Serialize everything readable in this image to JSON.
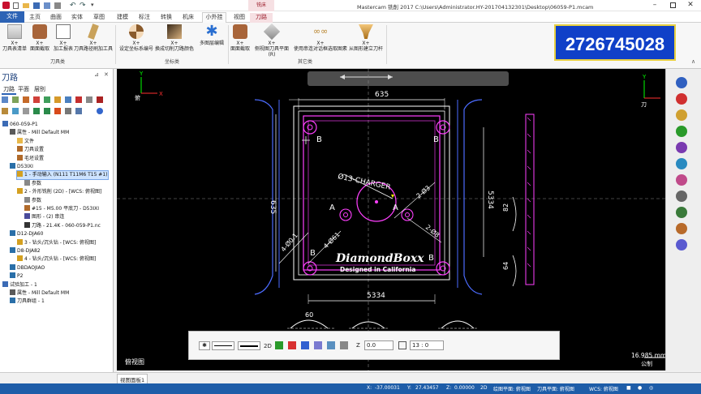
{
  "titlebar": {
    "title": "Mastercam 铣削 2017  C:\\Users\\Administrator.HY-201704132301\\Desktop\\06059-P1.mcam",
    "context_tab": "铣床"
  },
  "tabs": [
    "文件",
    "主页",
    "曲面",
    "实体",
    "草图",
    "建模",
    "标注",
    "转换",
    "机床",
    "小外挂",
    "视图",
    "刀路"
  ],
  "ribbon": {
    "buttons": [
      {
        "top": "X+",
        "label": "刀具表清单"
      },
      {
        "top": "X+",
        "label": "面面截取"
      },
      {
        "top": "X+",
        "label": "加工报表"
      },
      {
        "top": "X+",
        "label": "刀具路径刷加工具"
      },
      {
        "top": "X+",
        "label": "设定坐标系编号"
      },
      {
        "top": "X+",
        "label": "换成切削刀路颜色"
      },
      {
        "top": "",
        "label": "多图层编辑"
      },
      {
        "top": "X+",
        "label": "面面截取"
      },
      {
        "top": "X+",
        "label": "侧视图刀具平面(R)"
      },
      {
        "top": "X+",
        "label": "使用串连对话框选取图素"
      },
      {
        "top": "X+",
        "label": "从图形建立刀杆"
      }
    ],
    "groups": [
      "刀具类",
      "坐标类",
      "其它类"
    ]
  },
  "overlay_number": "2726745028",
  "left": {
    "panel_title": "刀路",
    "subtabs": [
      "刀路",
      "平面",
      "层别"
    ],
    "tree": [
      {
        "t": "060-059-P1",
        "lv": 0,
        "ic": "mach"
      },
      {
        "t": "属性 - Mill Default MM",
        "lv": 1,
        "ic": "prop"
      },
      {
        "t": "文件",
        "lv": 2,
        "ic": "folder"
      },
      {
        "t": "刀具设置",
        "lv": 2,
        "ic": "tool"
      },
      {
        "t": "毛坯设置",
        "lv": 2,
        "ic": "tool"
      },
      {
        "t": "D53IXI",
        "lv": 1,
        "ic": "grp"
      },
      {
        "t": "1 - 手动输入 (N111 T11M6 T15 #1)",
        "lv": 2,
        "ic": "op",
        "sel": true
      },
      {
        "t": "参数",
        "lv": 3,
        "ic": "param"
      },
      {
        "t": "2 - 外形铣削 (2D) - [WCS: 俯视图]",
        "lv": 2,
        "ic": "op"
      },
      {
        "t": "参数",
        "lv": 3,
        "ic": "param"
      },
      {
        "t": "#15 - M5.00 平底刀 - D53IXI",
        "lv": 3,
        "ic": "tool"
      },
      {
        "t": "图形 - (2) 串连",
        "lv": 3,
        "ic": "geo"
      },
      {
        "t": "刀路 - 21.4K - 060-059-P1.nc",
        "lv": 3,
        "ic": "path"
      },
      {
        "t": "D12-DJA60",
        "lv": 1,
        "ic": "grp"
      },
      {
        "t": "3 - 钻头/沉头钻 - [WCS: 俯视图]",
        "lv": 2,
        "ic": "op"
      },
      {
        "t": "D8-DJA82",
        "lv": 1,
        "ic": "grp"
      },
      {
        "t": "4 - 钻头/沉头钻 - [WCS: 俯视图]",
        "lv": 2,
        "ic": "op"
      },
      {
        "t": "DBDAOJIAO",
        "lv": 1,
        "ic": "grp"
      },
      {
        "t": "P2",
        "lv": 1,
        "ic": "grp"
      },
      {
        "t": "试验加工 - 1",
        "lv": 0,
        "ic": "mach"
      },
      {
        "t": "属性 - Mill Default MM",
        "lv": 1,
        "ic": "prop"
      },
      {
        "t": "刀具群组 - 1",
        "lv": 1,
        "ic": "grp"
      }
    ]
  },
  "drawing": {
    "dims": {
      "top": "635",
      "left": "635",
      "right": "5334",
      "bottom": "5334",
      "arc_bottom": "60",
      "rt1": "82",
      "rt2": "64",
      "diag1": "2-Ø3",
      "diag2": "2-Ø8",
      "diag3": "4-Ø0.1",
      "diag4": "4-Ø61",
      "charger": "Ø13-CHARGER"
    },
    "labels": {
      "a1": "A",
      "a2": "A",
      "b": "B"
    },
    "logo_line1": "DiamondBoxx",
    "logo_line2": "Designed in California",
    "view_left": "俯视图",
    "view_top": "俯",
    "axis_x": "X",
    "axis_y": "Y",
    "right_view": "刀",
    "scale": "16.985 mm",
    "scale_unit": "公制",
    "colors": {
      "bg": "#000000",
      "outline": "#ffffff",
      "magenta": "#ff40ff",
      "blue": "#4c6cff",
      "yellow": "#ffff00",
      "green": "#00ff00"
    }
  },
  "bottom_toolbar": {
    "mode": "2D",
    "z_label": "Z",
    "z_value": "0.0",
    "layer_value": "13 : 0"
  },
  "bottom_tab": "视图面板1",
  "status": {
    "x_label": "X:",
    "x": "-37.00031",
    "y_label": "Y:",
    "y": "27.43457",
    "z_label": "Z:",
    "z": "0.00000",
    "mode": "2D",
    "plane": "绘图平面: 俯视图",
    "tplane": "刀具平面: 俯视图",
    "wcs": "WCS: 俯视图"
  }
}
